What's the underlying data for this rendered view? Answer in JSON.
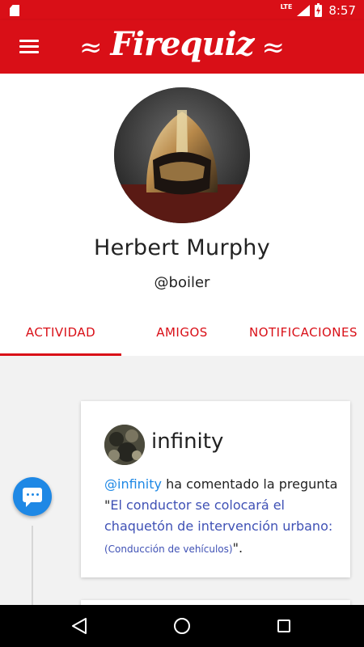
{
  "status_bar": {
    "network": "LTE",
    "time": "8:57",
    "icons": [
      "sd-card-icon",
      "signal-icon",
      "battery-charging-icon"
    ]
  },
  "app_bar": {
    "title": "Firequiz",
    "decor_left": "≈",
    "decor_right": "≈",
    "menu_icon": "hamburger-menu-icon"
  },
  "profile": {
    "name": "Herbert Murphy",
    "handle": "@boiler"
  },
  "tabs": [
    {
      "label": "ACTIVIDAD",
      "active": true
    },
    {
      "label": "AMIGOS",
      "active": false
    },
    {
      "label": "NOTIFICACIONES",
      "active": false
    }
  ],
  "activity": [
    {
      "user": "infinity",
      "mention": "@infinity",
      "text_before": " ha comentado la pregunta \"",
      "question": "El conductor se colocará el chaquetón de intervención urbano:",
      "category": " (Conducción de vehículos)",
      "text_after": "\"."
    }
  ],
  "colors": {
    "primary": "#d90f17",
    "accent": "#1e88e5",
    "link": "#3f51b5"
  }
}
